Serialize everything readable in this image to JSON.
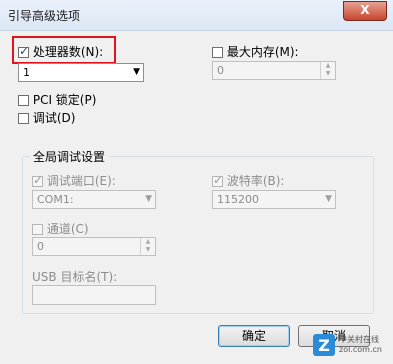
{
  "window": {
    "title": "引导高级选项",
    "close_label": "X"
  },
  "processor_count": {
    "label": "处理器数(N):",
    "checked": true,
    "value": "1"
  },
  "max_memory": {
    "label": "最大内存(M):",
    "checked": false,
    "value": "0"
  },
  "pci_lock": {
    "label": "PCI 锁定(P)",
    "checked": false
  },
  "debug": {
    "label": "调试(D)",
    "checked": false
  },
  "global_debug": {
    "title": "全局调试设置",
    "debug_port": {
      "label": "调试端口(E):",
      "checked": true,
      "value": "COM1:"
    },
    "baud_rate": {
      "label": "波特率(B):",
      "checked": true,
      "value": "115200"
    },
    "channel": {
      "label": "通道(C)",
      "checked": false,
      "value": "0"
    },
    "usb_target": {
      "label": "USB 目标名(T):",
      "value": ""
    }
  },
  "buttons": {
    "ok": "确定",
    "cancel": "取消"
  },
  "watermark": {
    "line1": "中关村在线",
    "line2": "zol.com.cn"
  },
  "colors": {
    "highlight": "#e0121b",
    "accent": "#3c7fb1"
  }
}
